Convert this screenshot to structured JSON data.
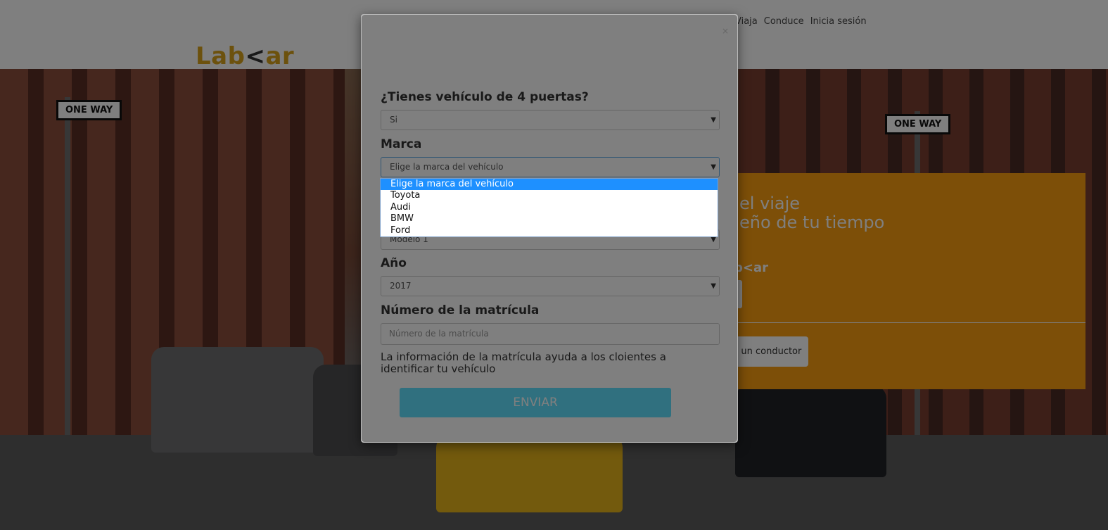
{
  "header": {
    "logo_left": "Lab",
    "logo_mark": "<",
    "logo_right": "ar",
    "nav": [
      "Viaja",
      "Conduce",
      "Inicia sesión"
    ]
  },
  "hero": {
    "signs": [
      "ONE WAY",
      "ONE WAY"
    ],
    "promo_title_1": "el viaje",
    "promo_title_2": "eño de tu tiempo",
    "promo_logo": "b<ar",
    "promo_button": "n un conductor"
  },
  "modal": {
    "close": "×",
    "q_doors": "¿Tienes vehículo de 4 puertas?",
    "doors_value": "Si",
    "brand_label": "Marca",
    "brand_value": "Elige la marca del vehículo",
    "brand_options": [
      "Elige la marca del vehículo",
      "Toyota",
      "Audi",
      "BMW",
      "Ford"
    ],
    "model_value": "Modelo 1",
    "year_label": "Año",
    "year_value": "2017",
    "plate_label": "Número de la matrícula",
    "plate_placeholder": "Número de la matrícula",
    "help_text": "La información de la matrícula ayuda a los cloientes a identificar tu vehículo",
    "submit": "ENVIAR"
  },
  "colors": {
    "promo": "#fb9f10",
    "submit": "#61e1ff",
    "logo": "#d9a21b",
    "selected_option": "#1e90ff"
  }
}
